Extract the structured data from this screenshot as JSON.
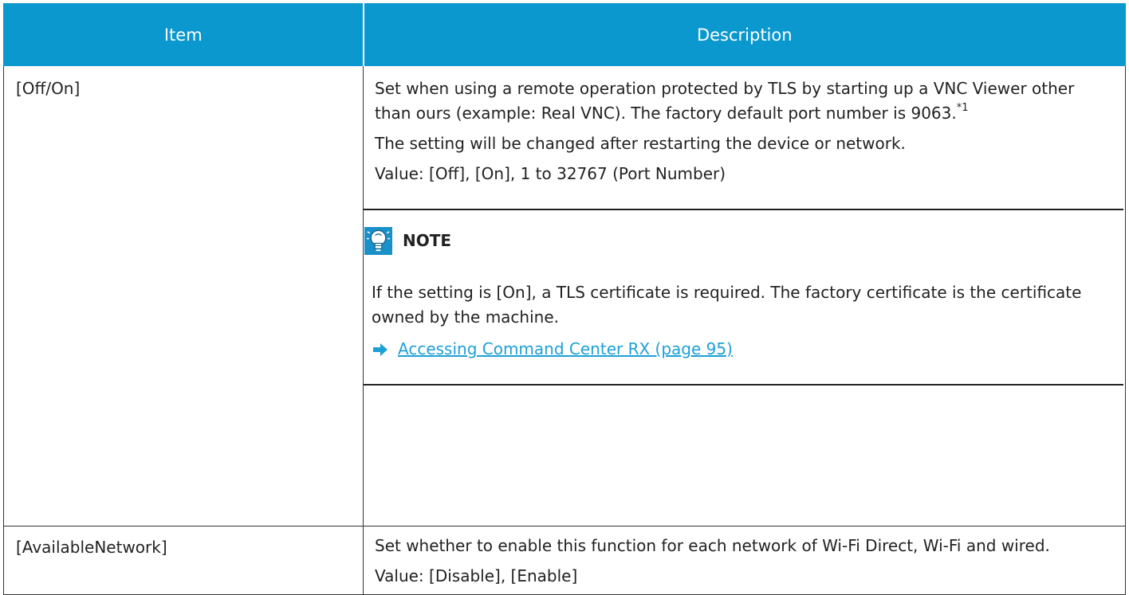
{
  "table": {
    "headers": {
      "item": "Item",
      "description": "Description"
    },
    "rows": [
      {
        "item": "[Off/On]",
        "desc_p1": "Set when using a remote operation protected by TLS by starting up a VNC Viewer other than ours (example: Real VNC). The factory default port number is 9063.",
        "desc_p1_sup": "*1",
        "desc_p2": "The setting will be changed after restarting the device or network.",
        "desc_p3": "Value: [Off], [On], 1 to 32767 (Port Number)",
        "note": {
          "icon": "note-lightbulb-icon",
          "title": "NOTE",
          "text": "If the setting is [On], a TLS certificate is required. The factory certificate is the certificate owned by the machine.",
          "link_icon": "arrow-right-icon",
          "link_text": "Accessing Command Center RX (page 95)"
        }
      },
      {
        "item": "[AvailableNetwork]",
        "desc_p1": "Set whether to enable this function for each network of Wi-Fi Direct, Wi-Fi and wired.",
        "desc_p2": "Value: [Disable], [Enable]"
      }
    ]
  },
  "colors": {
    "header_bg": "#0a98cf",
    "link": "#1ea0d6",
    "note_icon": "#1a90c8"
  }
}
